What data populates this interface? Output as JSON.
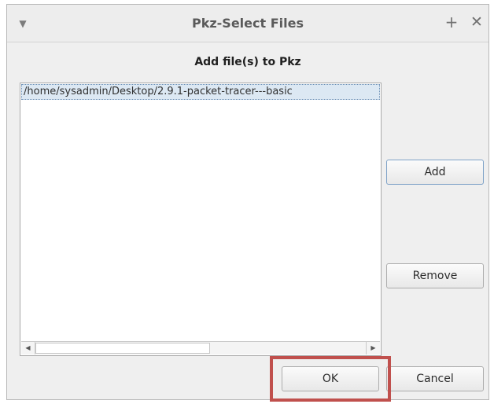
{
  "window": {
    "title": "Pkz-Select Files",
    "menu_glyph": "▼",
    "plus_glyph": "+",
    "close_glyph": "✕"
  },
  "dialog": {
    "heading": "Add file(s) to Pkz",
    "files": [
      "/home/sysadmin/Desktop/2.9.1-packet-tracer---basic"
    ]
  },
  "buttons": {
    "add": "Add",
    "remove": "Remove",
    "ok": "OK",
    "cancel": "Cancel"
  },
  "scrollbar": {
    "left_glyph": "◀",
    "right_glyph": "▶"
  },
  "colors": {
    "highlight": "#c0504d",
    "selection": "#dce8f3"
  }
}
